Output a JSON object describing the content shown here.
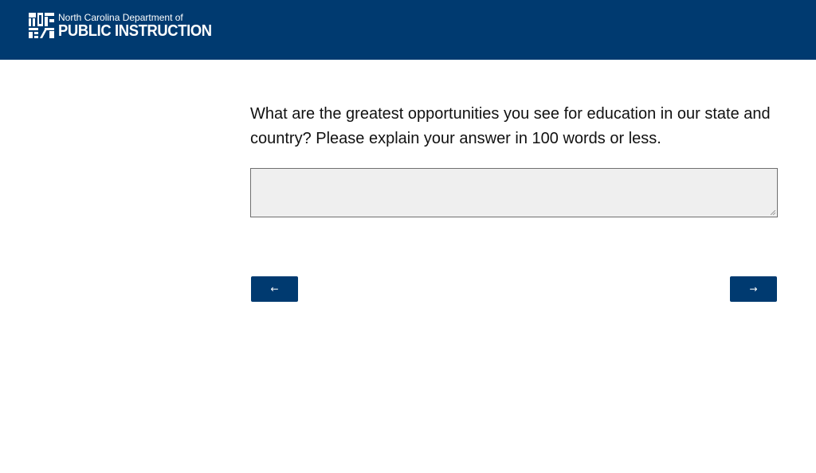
{
  "header": {
    "org_line1": "North Carolina Department of",
    "org_line2": "PUBLIC INSTRUCTION",
    "logo_icon": "ncdpi-logo-icon",
    "background_color": "#003a70"
  },
  "survey": {
    "question": "What are the greatest opportunities you see for education in our state and country? Please explain your answer in 100 words or less.",
    "answer_value": "",
    "answer_placeholder": ""
  },
  "navigation": {
    "prev_label": "←",
    "next_label": "→",
    "button_color": "#003a70"
  }
}
